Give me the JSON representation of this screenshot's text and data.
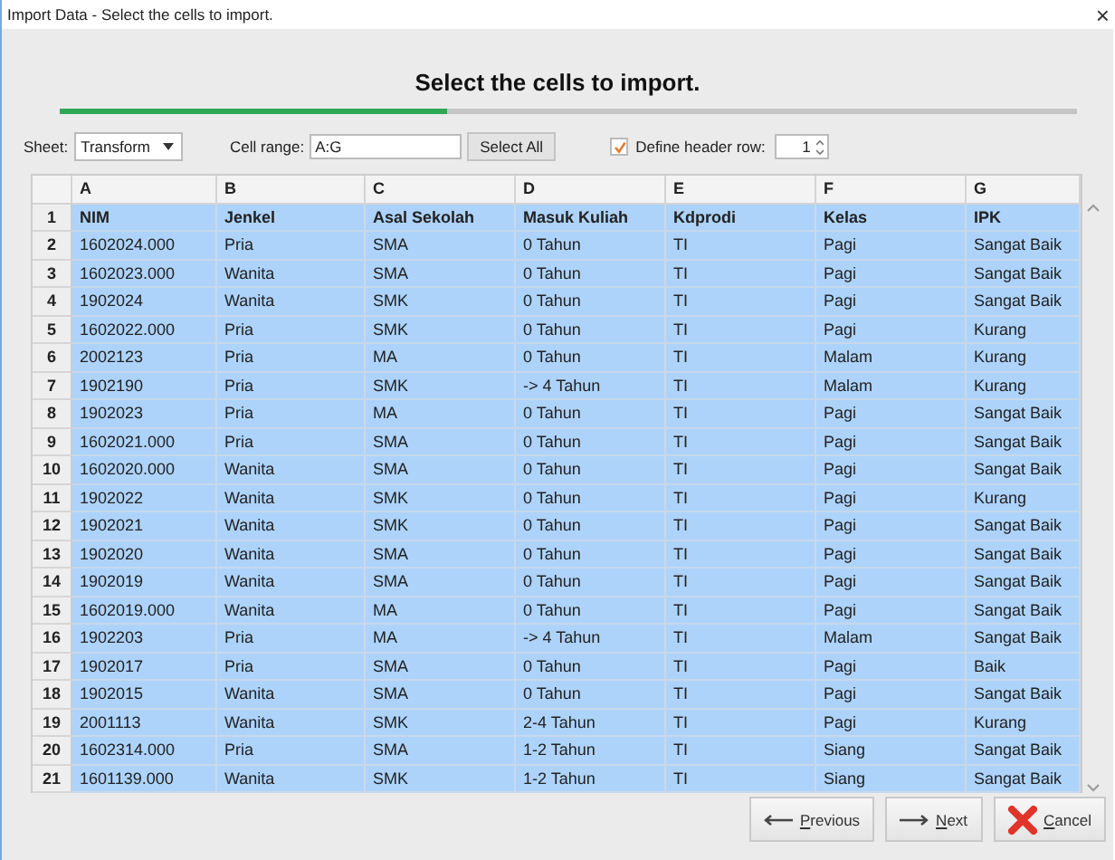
{
  "window": {
    "title": "Import Data - Select the cells to import.",
    "close": "×"
  },
  "heading": "Select the cells to import.",
  "progress": {
    "level": 0.38
  },
  "toolbar": {
    "sheet_label": "Sheet:",
    "sheet_value": "Transform",
    "range_label": "Cell range:",
    "range_value": "A:G",
    "select_all": "Select All",
    "header_checkbox": {
      "label": "Define header row:",
      "checked": true
    },
    "header_row_value": "1"
  },
  "table": {
    "columns": [
      "A",
      "B",
      "C",
      "D",
      "E",
      "F",
      "G"
    ],
    "rows": [
      {
        "number": "1",
        "header": true,
        "selected": true,
        "cells": [
          "NIM",
          "Jenkel",
          "Asal Sekolah",
          "Masuk Kuliah",
          "Kdprodi",
          "Kelas",
          "IPK"
        ]
      },
      {
        "number": "2",
        "header": false,
        "selected": true,
        "cells": [
          "1602024.000",
          "Pria",
          "SMA",
          "0 Tahun",
          "TI",
          "Pagi",
          "Sangat Baik"
        ]
      },
      {
        "number": "3",
        "header": false,
        "selected": true,
        "cells": [
          "1602023.000",
          "Wanita",
          "SMA",
          "0 Tahun",
          "TI",
          "Pagi",
          "Sangat Baik"
        ]
      },
      {
        "number": "4",
        "header": false,
        "selected": true,
        "cells": [
          "1902024",
          "Wanita",
          "SMK",
          "0 Tahun",
          "TI",
          "Pagi",
          "Sangat Baik"
        ]
      },
      {
        "number": "5",
        "header": false,
        "selected": true,
        "cells": [
          "1602022.000",
          "Pria",
          "SMK",
          "0 Tahun",
          "TI",
          "Pagi",
          "Kurang"
        ]
      },
      {
        "number": "6",
        "header": false,
        "selected": true,
        "cells": [
          "2002123",
          "Pria",
          "MA",
          "0 Tahun",
          "TI",
          "Malam",
          "Kurang"
        ]
      },
      {
        "number": "7",
        "header": false,
        "selected": true,
        "cells": [
          "1902190",
          "Pria",
          "SMK",
          "-> 4 Tahun",
          "TI",
          "Malam",
          "Kurang"
        ]
      },
      {
        "number": "8",
        "header": false,
        "selected": true,
        "cells": [
          "1902023",
          "Pria",
          "MA",
          "0 Tahun",
          "TI",
          "Pagi",
          "Sangat Baik"
        ]
      },
      {
        "number": "9",
        "header": false,
        "selected": true,
        "cells": [
          "1602021.000",
          "Pria",
          "SMA",
          "0 Tahun",
          "TI",
          "Pagi",
          "Sangat Baik"
        ]
      },
      {
        "number": "10",
        "header": false,
        "selected": true,
        "cells": [
          "1602020.000",
          "Wanita",
          "SMA",
          "0 Tahun",
          "TI",
          "Pagi",
          "Sangat Baik"
        ]
      },
      {
        "number": "11",
        "header": false,
        "selected": true,
        "cells": [
          "1902022",
          "Wanita",
          "SMK",
          "0 Tahun",
          "TI",
          "Pagi",
          "Kurang"
        ]
      },
      {
        "number": "12",
        "header": false,
        "selected": true,
        "cells": [
          "1902021",
          "Wanita",
          "SMK",
          "0 Tahun",
          "TI",
          "Pagi",
          "Sangat Baik"
        ]
      },
      {
        "number": "13",
        "header": false,
        "selected": true,
        "cells": [
          "1902020",
          "Wanita",
          "SMA",
          "0 Tahun",
          "TI",
          "Pagi",
          "Sangat Baik"
        ]
      },
      {
        "number": "14",
        "header": false,
        "selected": true,
        "cells": [
          "1902019",
          "Wanita",
          "SMA",
          "0 Tahun",
          "TI",
          "Pagi",
          "Sangat Baik"
        ]
      },
      {
        "number": "15",
        "header": false,
        "selected": true,
        "cells": [
          "1602019.000",
          "Wanita",
          "MA",
          "0 Tahun",
          "TI",
          "Pagi",
          "Sangat Baik"
        ]
      },
      {
        "number": "16",
        "header": false,
        "selected": true,
        "cells": [
          "1902203",
          "Pria",
          "MA",
          "-> 4 Tahun",
          "TI",
          "Malam",
          "Sangat Baik"
        ]
      },
      {
        "number": "17",
        "header": false,
        "selected": true,
        "cells": [
          "1902017",
          "Pria",
          "SMA",
          "0 Tahun",
          "TI",
          "Pagi",
          "Baik"
        ]
      },
      {
        "number": "18",
        "header": false,
        "selected": true,
        "cells": [
          "1902015",
          "Wanita",
          "SMA",
          "0 Tahun",
          "TI",
          "Pagi",
          "Sangat Baik"
        ]
      },
      {
        "number": "19",
        "header": false,
        "selected": true,
        "cells": [
          "2001113",
          "Wanita",
          "SMK",
          "2-4 Tahun",
          "TI",
          "Pagi",
          "Kurang"
        ]
      },
      {
        "number": "20",
        "header": false,
        "selected": true,
        "cells": [
          "1602314.000",
          "Pria",
          "SMA",
          "1-2 Tahun",
          "TI",
          "Siang",
          "Sangat Baik"
        ]
      },
      {
        "number": "21",
        "header": false,
        "selected": true,
        "cells": [
          "1601139.000",
          "Wanita",
          "SMK",
          "1-2 Tahun",
          "TI",
          "Siang",
          "Sangat Baik"
        ]
      }
    ]
  },
  "buttons": [
    {
      "kind": "previous",
      "label": "Previous"
    },
    {
      "kind": "next",
      "label": "Next"
    },
    {
      "kind": "cancel",
      "label": "Cancel"
    }
  ]
}
